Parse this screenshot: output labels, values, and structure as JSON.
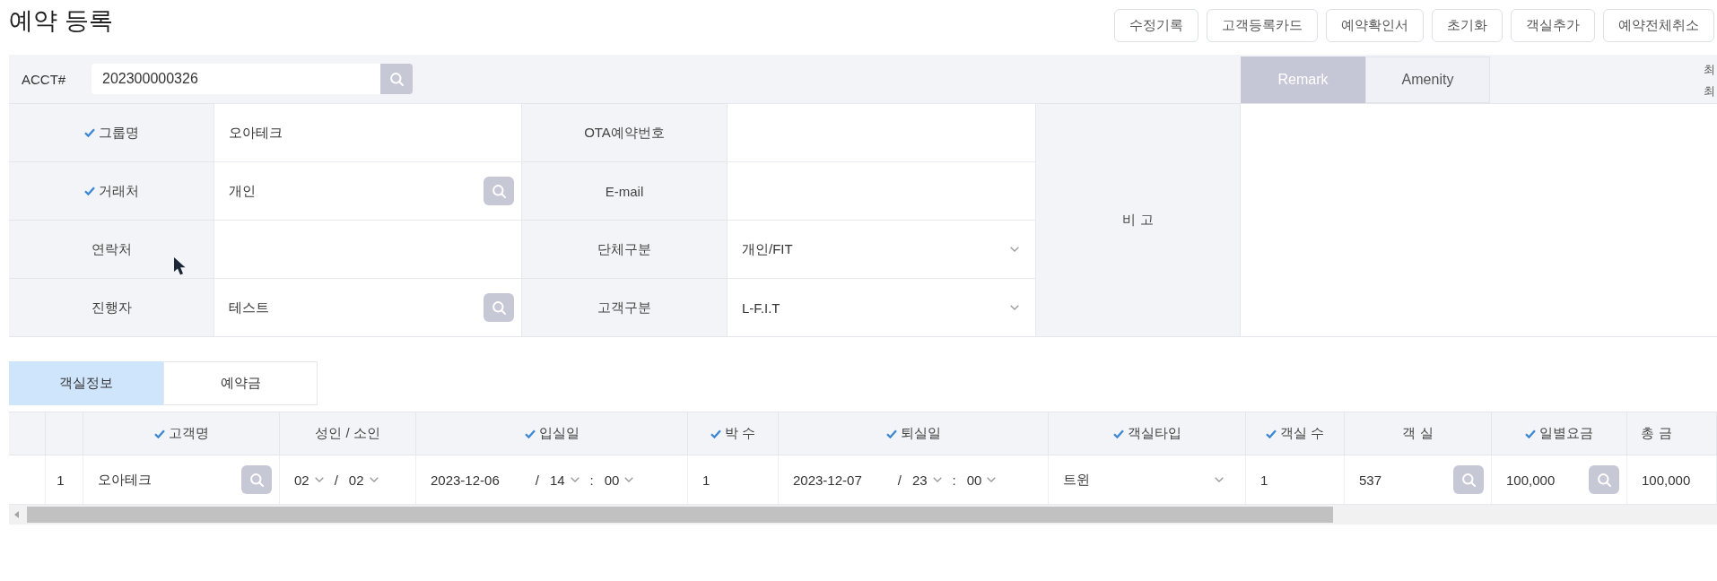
{
  "page": {
    "title": "예약 등록"
  },
  "toolbar": {
    "buttons": [
      "수정기록",
      "고객등록카드",
      "예약확인서",
      "초기화",
      "객실추가",
      "예약전체취소"
    ]
  },
  "account": {
    "label": "ACCT#",
    "value": "202300000326"
  },
  "form": {
    "rows": [
      {
        "fields": [
          {
            "label": "그룹명",
            "required": true,
            "kind": "text",
            "value": "오아테크"
          },
          {
            "label": "OTA예약번호",
            "required": false,
            "kind": "text"
          }
        ]
      },
      {
        "fields": [
          {
            "label": "거래처",
            "required": true,
            "kind": "lookup",
            "value": "개인"
          },
          {
            "label": "E-mail",
            "required": false,
            "kind": "text"
          }
        ]
      },
      {
        "fields": [
          {
            "label": "연락처",
            "required": false,
            "kind": "text"
          },
          {
            "label": "단체구분",
            "required": false,
            "kind": "select",
            "value": "개인/FIT"
          }
        ]
      },
      {
        "fields": [
          {
            "label": "진행자",
            "required": false,
            "kind": "lookup",
            "value": "테스트"
          },
          {
            "label": "고객구분",
            "required": false,
            "kind": "select",
            "value": "L-F.I.T"
          }
        ]
      }
    ]
  },
  "remarks": {
    "label": "비 고",
    "tabs": [
      {
        "label": "Remark",
        "selected": true
      },
      {
        "label": "Amenity",
        "selected": false
      }
    ],
    "side_notes": [
      "최",
      "최"
    ]
  },
  "section_tabs": [
    {
      "label": "객실정보",
      "selected": true
    },
    {
      "label": "예약금",
      "selected": false
    }
  ],
  "rooms_table": {
    "columns": [
      {
        "label": "고객명",
        "required": true
      },
      {
        "label": "성인 / 소인",
        "required": false
      },
      {
        "label": "입실일",
        "required": true
      },
      {
        "label": "박 수",
        "required": true
      },
      {
        "label": "퇴실일",
        "required": true
      },
      {
        "label": "객실타입",
        "required": true
      },
      {
        "label": "객실 수",
        "required": true
      },
      {
        "label": "객 실",
        "required": false
      },
      {
        "label": "일별요금",
        "required": true
      },
      {
        "label": "총 금",
        "required": false
      }
    ],
    "rows": [
      {
        "number": "1",
        "cells": [
          {
            "kind": "lookup",
            "value": "오아테크"
          },
          {
            "kind": "parts",
            "parts": [
              {
                "kind": "pick",
                "text": "02"
              },
              {
                "kind": "sep",
                "text": "/"
              },
              {
                "kind": "pick",
                "text": "02"
              }
            ]
          },
          {
            "kind": "parts",
            "parts": [
              {
                "kind": "date",
                "text": "2023-12-06"
              },
              {
                "kind": "sep",
                "text": "/"
              },
              {
                "kind": "pick",
                "text": "14"
              },
              {
                "kind": "sep",
                "text": ":"
              },
              {
                "kind": "pick",
                "text": "00"
              }
            ]
          },
          {
            "kind": "text",
            "value": "1"
          },
          {
            "kind": "parts",
            "parts": [
              {
                "kind": "date",
                "text": "2023-12-07"
              },
              {
                "kind": "sep",
                "text": "/"
              },
              {
                "kind": "pick",
                "text": "23"
              },
              {
                "kind": "sep",
                "text": ":"
              },
              {
                "kind": "pick",
                "text": "00"
              }
            ]
          },
          {
            "kind": "select",
            "value": "트윈"
          },
          {
            "kind": "text",
            "value": "1"
          },
          {
            "kind": "lookup",
            "value": "537"
          },
          {
            "kind": "lookup",
            "value": "100,000"
          },
          {
            "kind": "text",
            "value": "100,000"
          }
        ]
      }
    ]
  }
}
